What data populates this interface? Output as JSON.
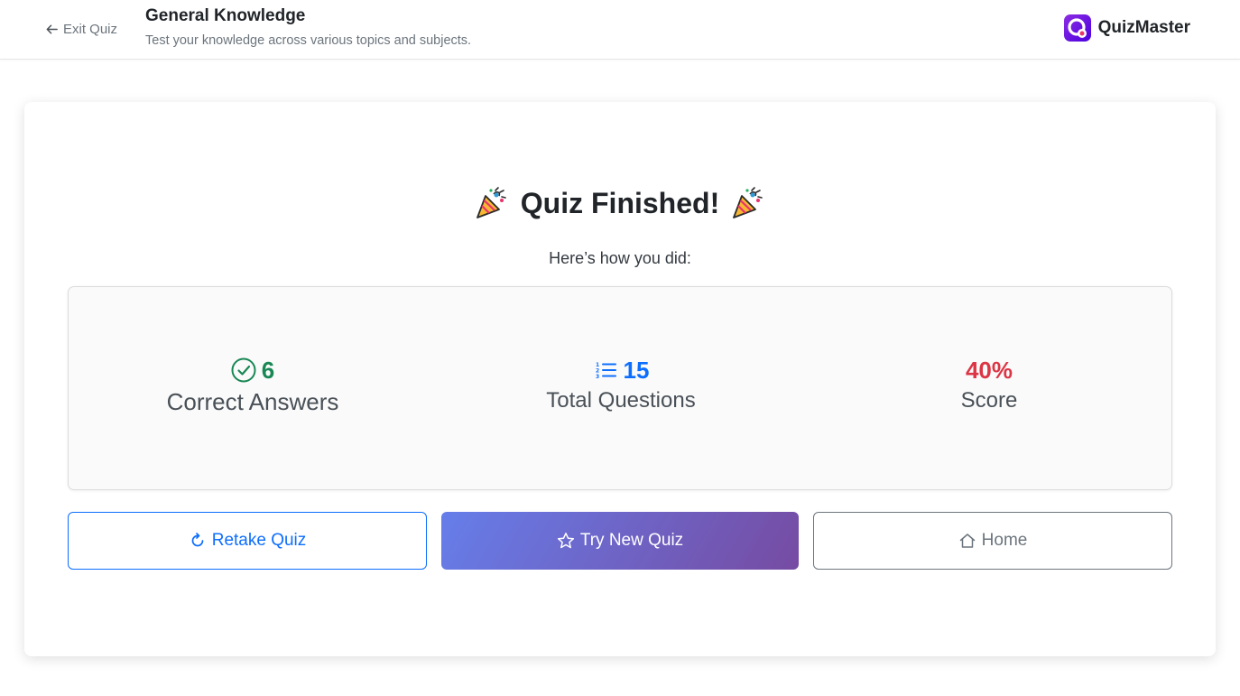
{
  "header": {
    "exit_label": "Exit Quiz",
    "quiz_title": "General Knowledge",
    "quiz_description": "Test your knowledge across various topics and subjects.",
    "brand_name": "QuizMaster"
  },
  "result": {
    "title": "Quiz Finished!",
    "subtitle": "Here’s how you did:",
    "title_icon": "party-popper-icon"
  },
  "stats": {
    "correct": {
      "value": "6",
      "label": "Correct Answers",
      "icon": "check-circle-icon",
      "color": "#198754"
    },
    "total": {
      "value": "15",
      "label": "Total Questions",
      "icon": "list-ol-icon",
      "color": "#0d6efd"
    },
    "score": {
      "value": "40%",
      "label": "Score",
      "color": "#dc3545"
    }
  },
  "actions": {
    "retake_label": "Retake Quiz",
    "new_quiz_label": "Try New Quiz",
    "home_label": "Home"
  },
  "colors": {
    "primary": "#0d6efd",
    "gradient_start": "#667eea",
    "gradient_end": "#764ba2",
    "muted": "#6c757d"
  }
}
